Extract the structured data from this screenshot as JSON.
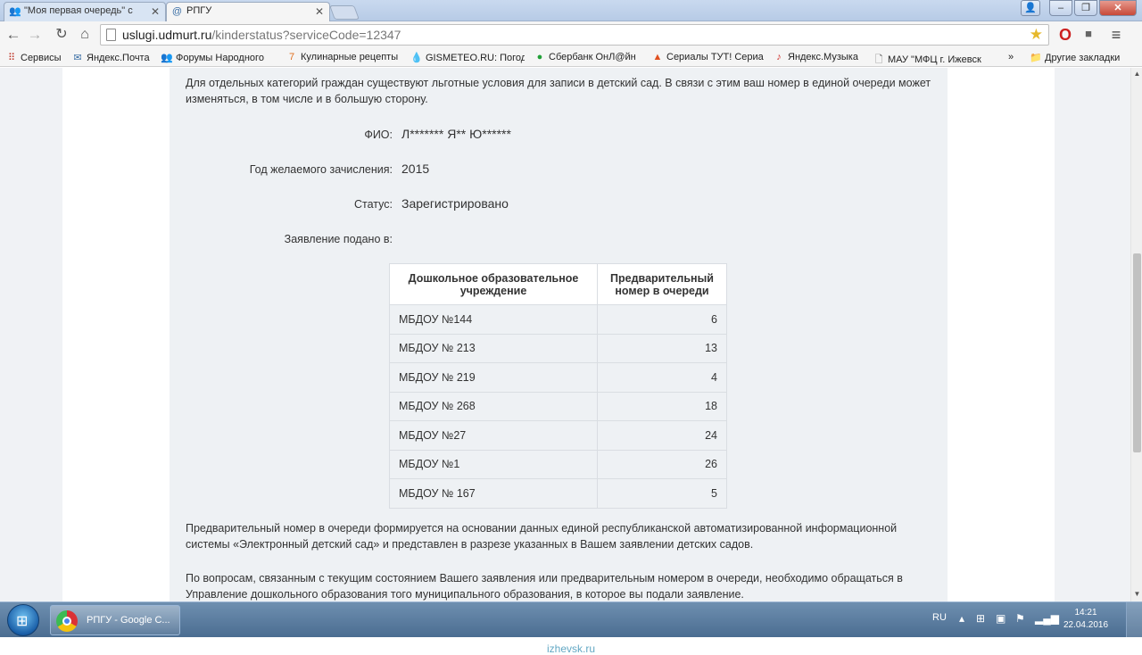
{
  "browser": {
    "tabs": [
      {
        "title": "\"Моя первая очередь\" с",
        "icon": "people-icon"
      },
      {
        "title": "РПГУ",
        "icon": "at-sign-icon"
      }
    ],
    "url_host": "uslugi.udmurt.ru",
    "url_path": "/kinderstatus?serviceCode=12347",
    "bookmarks": [
      {
        "label": "Сервисы",
        "icon": "apps-grid-icon"
      },
      {
        "label": "Яндекс.Почта",
        "icon": "mail-icon"
      },
      {
        "label": "Форумы Народного",
        "icon": "people-icon"
      },
      {
        "label": "Кулинарные рецепты",
        "icon": "cooking-icon"
      },
      {
        "label": "GISMETEO.RU: Погод",
        "icon": "weather-drop-icon"
      },
      {
        "label": "Сбербанк ОнЛ@йн",
        "icon": "sberbank-icon"
      },
      {
        "label": "Сериалы ТУТ! Сериа",
        "icon": "tv-icon"
      },
      {
        "label": "Яндекс.Музыка",
        "icon": "music-icon"
      },
      {
        "label": "МАУ \"МФЦ г. Ижевск",
        "icon": "page-icon"
      }
    ],
    "more_bookmarks": "»",
    "other_bookmarks": "Другие закладки"
  },
  "page": {
    "intro": "Для отдельных категорий граждан существуют льготные условия для записи в детский сад. В связи с этим ваш номер в единой очереди может изменяться, в том числе и в большую сторону.",
    "fio_label": "ФИО:",
    "fio_value": "Л******* Я** Ю******",
    "year_label": "Год желаемого зачисления:",
    "year_value": "2015",
    "status_label": "Статус:",
    "status_value": "Зарегистрировано",
    "applied_label": "Заявление подано в:",
    "table": {
      "headers": [
        "Дошкольное образовательное учреждение",
        "Предварительный номер в очереди"
      ],
      "rows": [
        {
          "institution": "МБДОУ №144",
          "number": "6"
        },
        {
          "institution": "МБДОУ № 213",
          "number": "13"
        },
        {
          "institution": "МБДОУ № 219",
          "number": "4"
        },
        {
          "institution": "МБДОУ № 268",
          "number": "18"
        },
        {
          "institution": "МБДОУ №27",
          "number": "24"
        },
        {
          "institution": "МБДОУ №1",
          "number": "26"
        },
        {
          "institution": "МБДОУ № 167",
          "number": "5"
        }
      ]
    },
    "note": "Предварительный номер в очереди формируется на основании данных единой республиканской автоматизированной информационной системы «Электронный детский сад» и представлен в разрезе указанных в Вашем заявлении детских садов.",
    "contact": "По вопросам, связанным с текущим состоянием Вашего заявления или предварительным номером в очереди, необходимо обращаться в Управление дошкольного образования того муниципального образования, в которое вы подали заявление."
  },
  "taskbar": {
    "task_label": "РПГУ - Google C...",
    "lang": "RU",
    "time": "14:21",
    "date": "22.04.2016"
  },
  "watermark": "izhevsk.ru"
}
